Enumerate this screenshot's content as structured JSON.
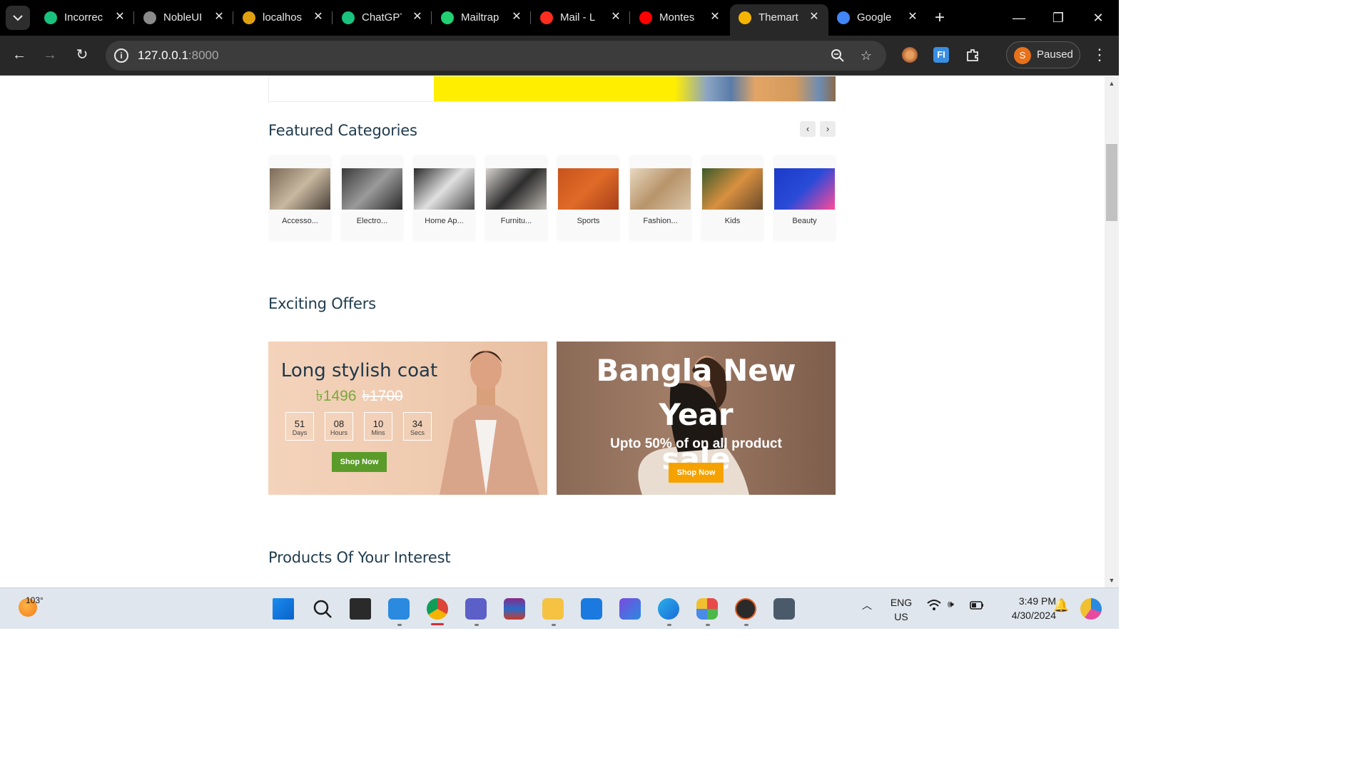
{
  "browser": {
    "tabs": [
      {
        "title": "Incorrec",
        "favicon": "chatgpt-icon",
        "color": "#19c37d"
      },
      {
        "title": "NobleUI",
        "favicon": "globe-icon",
        "color": "#8a8a8a"
      },
      {
        "title": "localhos",
        "favicon": "mountain-icon",
        "color": "#e0a010"
      },
      {
        "title": "ChatGPT",
        "favicon": "chatgpt-icon",
        "color": "#19c37d"
      },
      {
        "title": "Mailtrap",
        "favicon": "mailtrap-icon",
        "color": "#22d172"
      },
      {
        "title": "Mail - L",
        "favicon": "laravel-icon",
        "color": "#ff2d20"
      },
      {
        "title": "Montes",
        "favicon": "youtube-icon",
        "color": "#ff0000"
      },
      {
        "title": "Themart",
        "favicon": "themart-icon",
        "color": "#f5b400",
        "active": true
      },
      {
        "title": "Google",
        "favicon": "google-icon",
        "color": "#4285f4"
      }
    ],
    "url_host": "127.0.0.1",
    "url_port": ":8000",
    "profile_initial": "S",
    "profile_label": "Paused"
  },
  "page": {
    "featured_title": "Featured Categories",
    "categories": [
      {
        "name": "Accesso...",
        "colors": [
          "#7a6a58",
          "#c8b8a0",
          "#4a4038"
        ]
      },
      {
        "name": "Electro...",
        "colors": [
          "#3a3a3a",
          "#9a9a9a",
          "#2a2a2a"
        ]
      },
      {
        "name": "Home Ap...",
        "colors": [
          "#2a2a2a",
          "#e0e0e0",
          "#4a4a4a"
        ]
      },
      {
        "name": "Furnitu...",
        "colors": [
          "#d8d4d0",
          "#2e2e2e",
          "#bcb6b0"
        ]
      },
      {
        "name": "Sports",
        "colors": [
          "#c8541c",
          "#e06a28",
          "#a8401a"
        ]
      },
      {
        "name": "Fashion...",
        "colors": [
          "#e8d8c0",
          "#b8946a",
          "#d8c4a8"
        ]
      },
      {
        "name": "Kids",
        "colors": [
          "#3a5a2a",
          "#d89040",
          "#6a4a2a"
        ]
      },
      {
        "name": "Beauty",
        "colors": [
          "#1a3ac8",
          "#2a4ad8",
          "#ff4a9a"
        ]
      }
    ],
    "offers_title": "Exciting Offers",
    "offer1": {
      "title": "Long stylish coat",
      "price_new": "৳1496",
      "price_old": "৳1700",
      "countdown": [
        {
          "value": "51",
          "unit": "Days"
        },
        {
          "value": "08",
          "unit": "Hours"
        },
        {
          "value": "10",
          "unit": "Mins"
        },
        {
          "value": "34",
          "unit": "Secs"
        }
      ],
      "button": "Shop Now"
    },
    "offer2": {
      "title_line1": "Bangla New Year",
      "title_line2": "sale",
      "subtitle": "Upto 50% of on all product",
      "button": "Shop Now"
    },
    "products_title": "Products Of Your Interest"
  },
  "taskbar": {
    "temperature": "103°",
    "lang_line1": "ENG",
    "lang_line2": "US",
    "time": "3:49 PM",
    "date": "4/30/2024"
  }
}
